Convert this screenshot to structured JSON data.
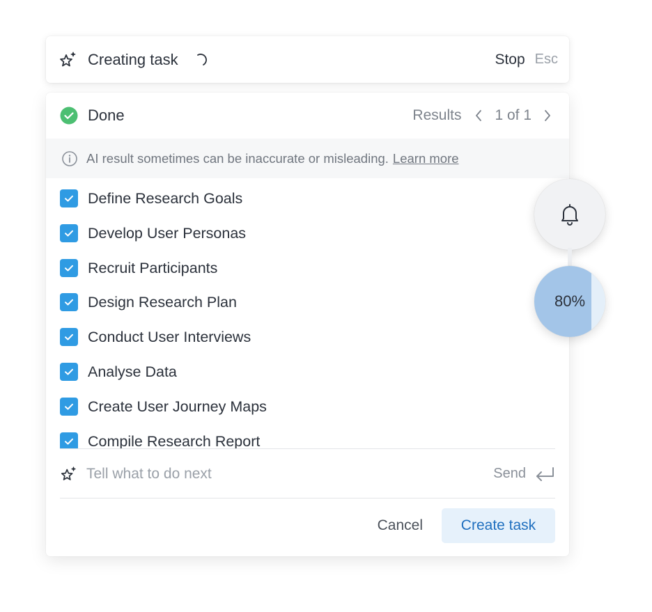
{
  "topbar": {
    "icon": "sparkle-star-icon",
    "title": "Creating task",
    "stop_label": "Stop",
    "esc_hint": "Esc"
  },
  "status": {
    "icon": "check-circle-icon",
    "label": "Done",
    "results_label": "Results",
    "page_indicator": "1 of 1"
  },
  "notice": {
    "icon": "info-icon",
    "text": "AI result sometimes can be inaccurate or misleading.",
    "link": "Learn more"
  },
  "tasks": [
    {
      "label": "Define Research Goals",
      "checked": true
    },
    {
      "label": "Develop User Personas",
      "checked": true
    },
    {
      "label": "Recruit Participants",
      "checked": true
    },
    {
      "label": "Design Research Plan",
      "checked": true
    },
    {
      "label": "Conduct User Interviews",
      "checked": true
    },
    {
      "label": "Analyse Data",
      "checked": true
    },
    {
      "label": "Create User Journey Maps",
      "checked": true
    },
    {
      "label": "Compile Research Report",
      "checked": true
    }
  ],
  "prompt": {
    "placeholder": "Tell what to do next",
    "value": "",
    "send_label": "Send"
  },
  "footer": {
    "cancel_label": "Cancel",
    "create_label": "Create task"
  },
  "progress": {
    "percent_label": "80%",
    "fraction": 0.8
  },
  "colors": {
    "accent": "#2f9be3",
    "success": "#4cbf72",
    "primary_text": "#1f6fbf",
    "progress_fill": "#a3c5e8"
  }
}
